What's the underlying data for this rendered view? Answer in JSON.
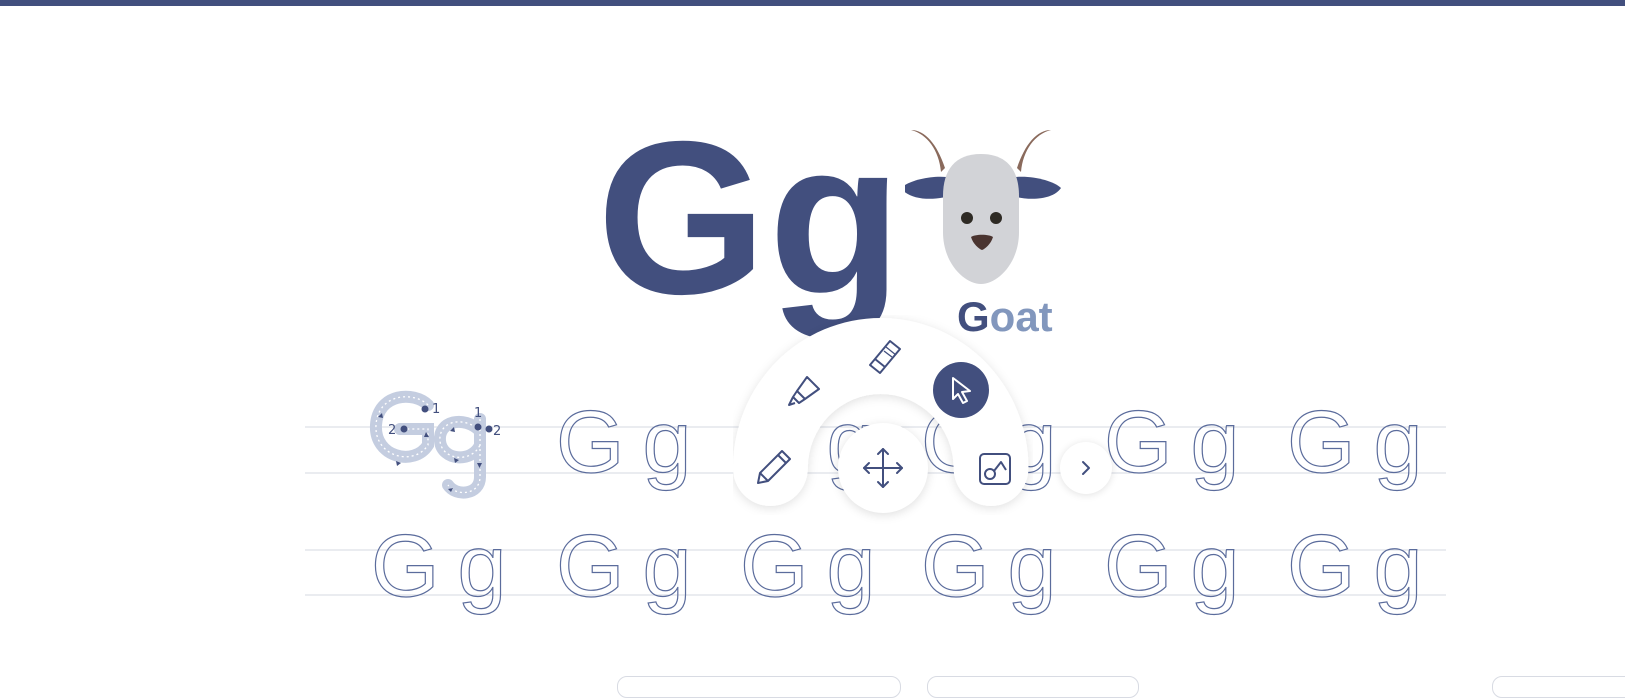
{
  "colors": {
    "accent": "#424f7e",
    "light_accent": "#8297bd",
    "trace_model": "#c4cde0",
    "goat_horn": "#8a6a5c",
    "goat_face": "#d2d3d7"
  },
  "lesson": {
    "letters": "Gg",
    "word_first": "G",
    "word_rest": "oat"
  },
  "practice": {
    "cell_text": "Gg",
    "model_stroke_numbers": [
      "1",
      "2",
      "1",
      "2"
    ]
  },
  "toolbar": {
    "tools": [
      {
        "name": "marker",
        "icon": "marker-icon",
        "selected": false
      },
      {
        "name": "eraser",
        "icon": "eraser-icon",
        "selected": false
      },
      {
        "name": "select",
        "icon": "cursor-arrow-icon",
        "selected": true
      },
      {
        "name": "pencil",
        "icon": "pencil-icon",
        "selected": false
      },
      {
        "name": "move",
        "icon": "move-arrows-icon",
        "selected": false
      },
      {
        "name": "shapes",
        "icon": "shapes-icon",
        "selected": false
      }
    ],
    "next_icon": "chevron-right-icon"
  }
}
